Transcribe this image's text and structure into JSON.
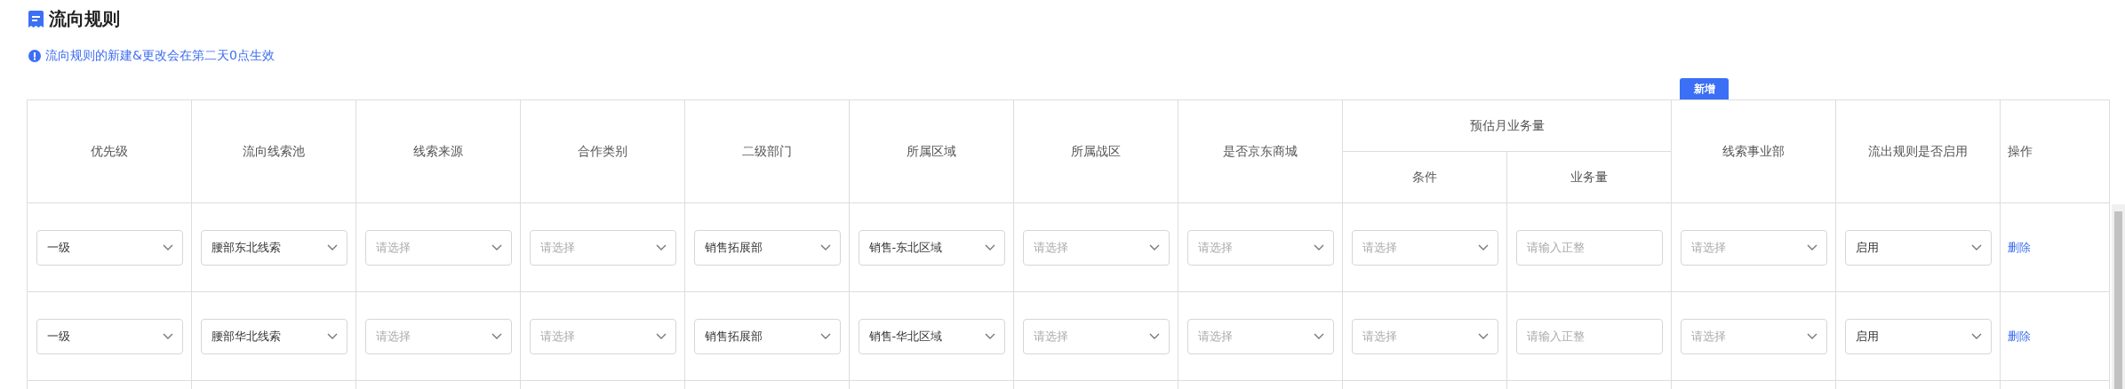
{
  "title": "流向规则",
  "notice": "流向规则的新建&更改会在第二天0点生效",
  "add_button": "新增",
  "table": {
    "columns": [
      {
        "label": "优先级"
      },
      {
        "label": "流向线索池"
      },
      {
        "label": "线索来源"
      },
      {
        "label": "合作类别"
      },
      {
        "label": "二级部门"
      },
      {
        "label": "所属区域"
      },
      {
        "label": "所属战区"
      },
      {
        "label": "是否京东商城"
      },
      {
        "label": "条件",
        "group_label": "预估月业务量"
      },
      {
        "label": "业务量",
        "in_group": true
      },
      {
        "label": "线索事业部"
      },
      {
        "label": "流出规则是否启用"
      },
      {
        "label": "操作"
      }
    ],
    "rows": [
      {
        "cells": [
          {
            "kind": "select",
            "value": "一级"
          },
          {
            "kind": "select",
            "value": "腰部东北线索"
          },
          {
            "kind": "select",
            "placeholder": "请选择"
          },
          {
            "kind": "select",
            "placeholder": "请选择"
          },
          {
            "kind": "select",
            "value": "销售拓展部"
          },
          {
            "kind": "select",
            "value": "销售-东北区域"
          },
          {
            "kind": "select",
            "placeholder": "请选择"
          },
          {
            "kind": "select",
            "placeholder": "请选择"
          },
          {
            "kind": "select",
            "placeholder": "请选择"
          },
          {
            "kind": "input",
            "placeholder": "请输入正整"
          },
          {
            "kind": "select",
            "placeholder": "请选择"
          },
          {
            "kind": "select",
            "value": "启用"
          },
          {
            "kind": "link",
            "text": "删除"
          }
        ]
      },
      {
        "cells": [
          {
            "kind": "select",
            "value": "一级"
          },
          {
            "kind": "select",
            "value": "腰部华北线索"
          },
          {
            "kind": "select",
            "placeholder": "请选择"
          },
          {
            "kind": "select",
            "placeholder": "请选择"
          },
          {
            "kind": "select",
            "value": "销售拓展部"
          },
          {
            "kind": "select",
            "value": "销售-华北区域"
          },
          {
            "kind": "select",
            "placeholder": "请选择"
          },
          {
            "kind": "select",
            "placeholder": "请选择"
          },
          {
            "kind": "select",
            "placeholder": "请选择"
          },
          {
            "kind": "input",
            "placeholder": "请输入正整"
          },
          {
            "kind": "select",
            "placeholder": "请选择"
          },
          {
            "kind": "select",
            "value": "启用"
          },
          {
            "kind": "link",
            "text": "删除"
          }
        ]
      }
    ]
  }
}
